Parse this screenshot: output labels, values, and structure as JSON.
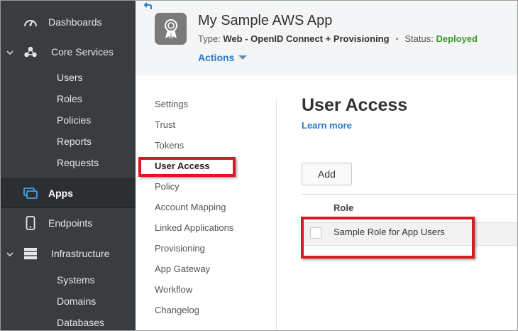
{
  "sidebar": {
    "items": [
      {
        "label": "Dashboards",
        "icon": "gauge-icon"
      },
      {
        "label": "Core Services",
        "icon": "core-services-icon",
        "expanded": true,
        "children": [
          "Users",
          "Roles",
          "Policies",
          "Reports",
          "Requests"
        ]
      },
      {
        "label": "Apps",
        "icon": "apps-icon",
        "active": true
      },
      {
        "label": "Endpoints",
        "icon": "mobile-device-icon"
      },
      {
        "label": "Infrastructure",
        "icon": "server-stack-icon",
        "expanded": true,
        "children": [
          "Systems",
          "Domains",
          "Databases"
        ]
      }
    ]
  },
  "header": {
    "title": "My Sample AWS App",
    "type_label": "Type:",
    "type_value": "Web - OpenID Connect + Provisioning",
    "separator": "•",
    "status_label": "Status:",
    "status_value": "Deployed",
    "actions_label": "Actions"
  },
  "settings_menu": {
    "items": [
      "Settings",
      "Trust",
      "Tokens",
      "User Access",
      "Policy",
      "Account Mapping",
      "Linked Applications",
      "Provisioning",
      "App Gateway",
      "Workflow",
      "Changelog"
    ],
    "selected": "User Access"
  },
  "main": {
    "title": "User Access",
    "learn_more": "Learn more",
    "add_button": "Add",
    "table": {
      "columns": [
        "Role"
      ],
      "rows": [
        [
          "Sample Role for App Users"
        ]
      ]
    }
  },
  "colors": {
    "sidebar_bg": "#3a3d40",
    "link": "#2b7bc2",
    "status_ok": "#3a9a28",
    "highlight": "#d61b22"
  }
}
